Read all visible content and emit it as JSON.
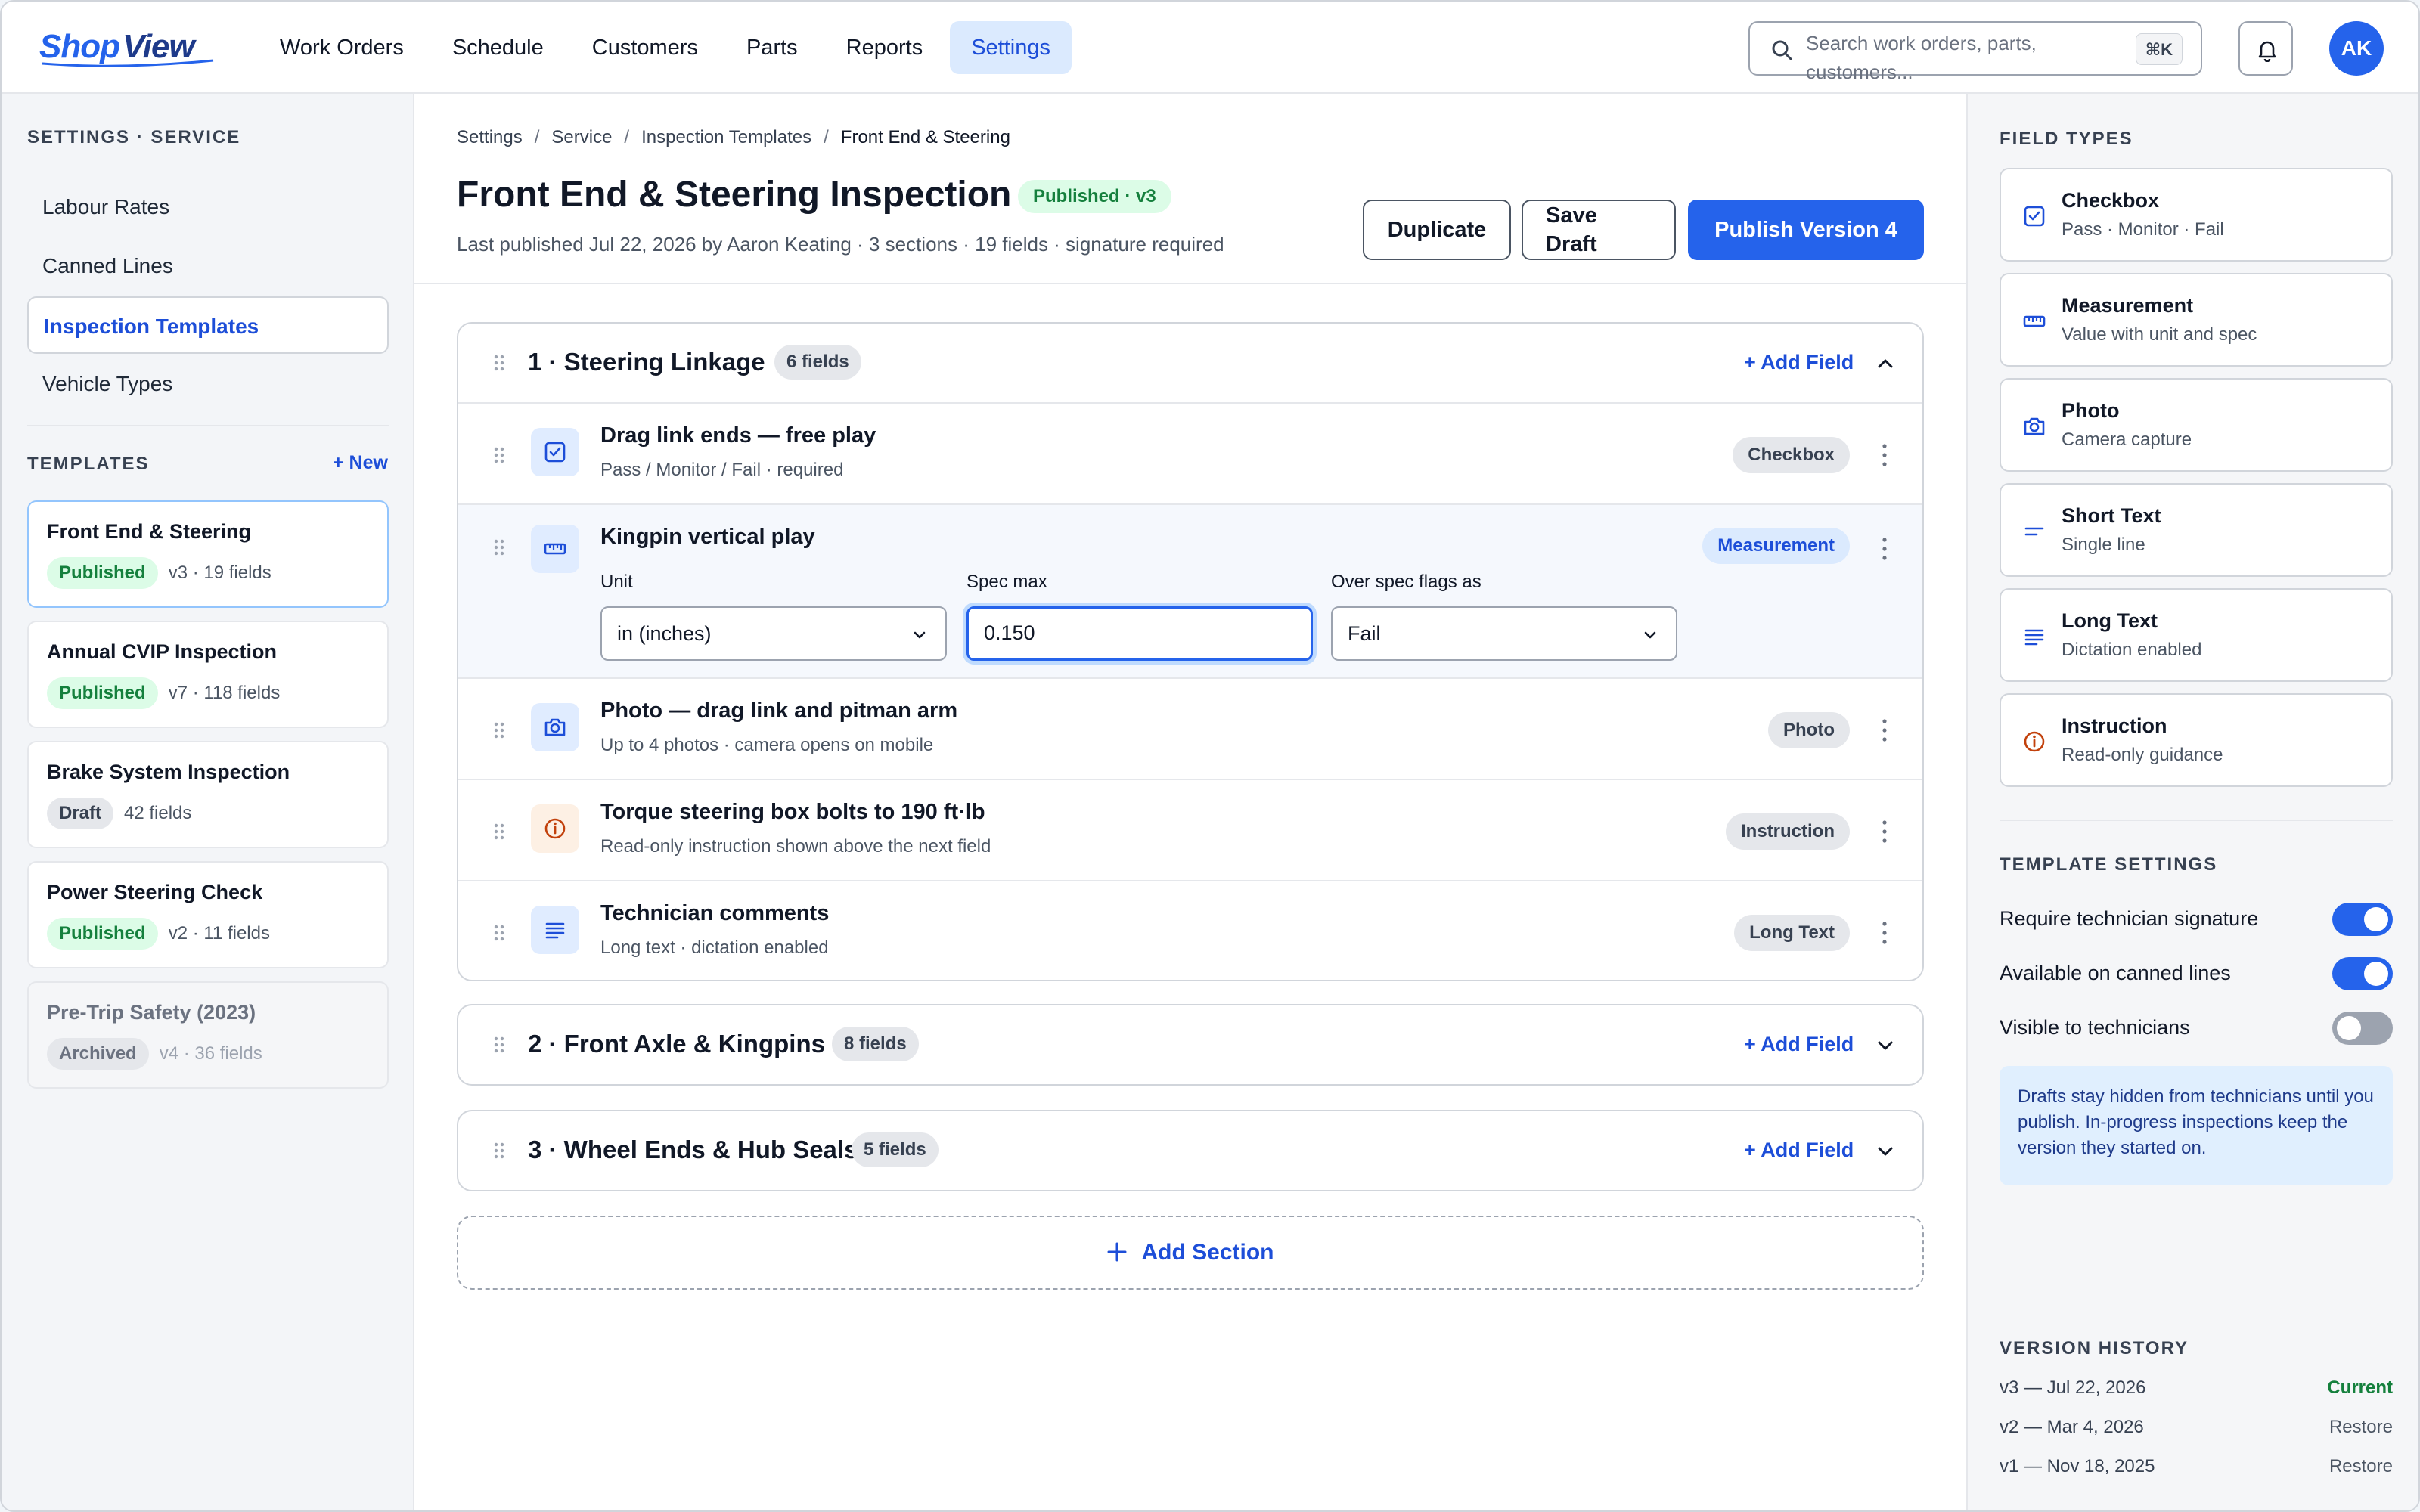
{
  "app": {
    "logo_text": "ShopView",
    "brand_color": "#2563eb"
  },
  "nav": {
    "items": [
      {
        "label": "Work Orders"
      },
      {
        "label": "Schedule"
      },
      {
        "label": "Customers"
      },
      {
        "label": "Parts"
      },
      {
        "label": "Reports"
      },
      {
        "label": "Settings",
        "active": true
      }
    ],
    "search_placeholder": "Search work orders, parts, customers...",
    "search_shortcut": "⌘K",
    "user_initials": "AK"
  },
  "sidebar": {
    "heading": "SETTINGS · SERVICE",
    "menu": [
      {
        "label": "Labour Rates"
      },
      {
        "label": "Canned Lines"
      },
      {
        "label": "Inspection Templates",
        "active": true
      },
      {
        "label": "Vehicle Types"
      }
    ],
    "templates_heading": "TEMPLATES",
    "new_label": "+ New",
    "templates": [
      {
        "name": "Front End & Steering",
        "status": "Published",
        "meta": "v3 · 19 fields"
      },
      {
        "name": "Annual CVIP Inspection",
        "status": "Published",
        "meta": "v7 · 118 fields"
      },
      {
        "name": "Brake System Inspection",
        "status": "Draft",
        "meta": "42 fields"
      },
      {
        "name": "Power Steering Check",
        "status": "Published",
        "meta": "v2 · 11 fields"
      },
      {
        "name": "Pre-Trip Safety (2023)",
        "status": "Archived",
        "meta": "v4 · 36 fields"
      }
    ]
  },
  "main": {
    "breadcrumb": [
      "Settings",
      "Service",
      "Inspection Templates",
      "Front End & Steering"
    ],
    "title": "Front End & Steering Inspection",
    "status_badge": "Published · v3",
    "subline": "Last published Jul 22, 2026 by Aaron Keating · 3 sections · 19 fields · signature required",
    "buttons": {
      "duplicate": "Duplicate",
      "save_draft": "Save Draft",
      "publish": "Publish Version 4"
    },
    "add_field_label": "+ Add Field",
    "add_section_label": "Add Section",
    "sections": [
      {
        "title": "1 · Steering Linkage",
        "count": "6 fields",
        "fields": [
          {
            "name": "Drag link ends — free play",
            "desc": "Pass / Monitor / Fail · required",
            "type": "Checkbox",
            "icon": "checkbox-icon"
          },
          {
            "name": "Kingpin vertical play",
            "type": "Measurement",
            "icon": "ruler-icon",
            "unit_label": "Unit",
            "unit_value": "in (inches)",
            "spec_label": "Spec max",
            "spec_value": "0.150",
            "flag_label": "Over spec flags as",
            "flag_value": "Fail"
          },
          {
            "name": "Photo — drag link and pitman arm",
            "desc": "Up to 4 photos · camera opens on mobile",
            "type": "Photo",
            "icon": "camera-icon"
          },
          {
            "name": "Torque steering box bolts to 190 ft·lb",
            "desc": "Read-only instruction shown above the next field",
            "type": "Instruction",
            "icon": "info-icon"
          },
          {
            "name": "Technician comments",
            "desc": "Long text · dictation enabled",
            "type": "Long Text",
            "icon": "long-text-icon"
          }
        ]
      },
      {
        "title": "2 · Front Axle & Kingpins",
        "count": "8 fields"
      },
      {
        "title": "3 · Wheel Ends & Hub Seals",
        "count": "5 fields"
      }
    ]
  },
  "right": {
    "field_types_heading": "FIELD TYPES",
    "field_types": [
      {
        "name": "Checkbox",
        "desc": "Pass · Monitor · Fail",
        "icon": "checkbox-icon"
      },
      {
        "name": "Measurement",
        "desc": "Value with unit and spec",
        "icon": "ruler-icon"
      },
      {
        "name": "Photo",
        "desc": "Camera capture",
        "icon": "camera-icon"
      },
      {
        "name": "Short Text",
        "desc": "Single line",
        "icon": "short-text-icon"
      },
      {
        "name": "Long Text",
        "desc": "Dictation enabled",
        "icon": "long-text-icon"
      },
      {
        "name": "Instruction",
        "desc": "Read-only guidance",
        "icon": "info-icon"
      }
    ],
    "settings_heading": "TEMPLATE SETTINGS",
    "toggles": [
      {
        "label": "Require technician signature",
        "on": true
      },
      {
        "label": "Available on canned lines",
        "on": true
      },
      {
        "label": "Visible to technicians",
        "on": false
      }
    ],
    "info": "Drafts stay hidden from technicians until you publish. In-progress inspections keep the version they started on.",
    "version_heading": "VERSION HISTORY",
    "versions": [
      {
        "label": "v3 — Jul 22, 2026",
        "action": "Current"
      },
      {
        "label": "v2 — Mar 4, 2026",
        "action": "Restore"
      },
      {
        "label": "v1 — Nov 18, 2025",
        "action": "Restore"
      }
    ]
  }
}
